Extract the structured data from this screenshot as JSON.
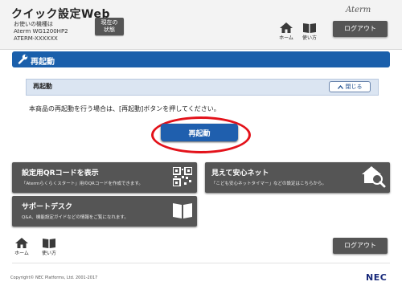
{
  "header": {
    "app_title": "クイック設定Web",
    "device_label": "お使いの機種は",
    "device_model": "Aterm WG1200HP2",
    "device_name": "ATERM-XXXXXX",
    "status_button_line1": "現在の",
    "status_button_line2": "状態",
    "brand": "Aterm",
    "home_label": "ホーム",
    "help_label": "使い方",
    "logout_label": "ログアウト"
  },
  "section": {
    "title": "再起動",
    "panel_title": "再起動",
    "close_label": "閉じる",
    "description": "本商品の再起動を行う場合は、[再起動]ボタンを押してください。",
    "restart_button": "再起動"
  },
  "tiles": [
    {
      "title": "設定用QRコードを表示",
      "subtitle": "「Atermらくらくスタート」用のQRコードを作成できます。",
      "icon": "qr-code-icon"
    },
    {
      "title": "見えて安心ネット",
      "subtitle": "「こども安心ネットタイマー」などの設定はこちらから。",
      "icon": "house-search-icon"
    },
    {
      "title": "サポートデスク",
      "subtitle": "Q&A、機能設定ガイドなどの情報をご覧になれます。",
      "icon": "book-icon"
    }
  ],
  "footer": {
    "home_label": "ホーム",
    "help_label": "使い方",
    "logout_label": "ログアウト",
    "copyright": "Copyright© NEC Platforms, Ltd. 2001-2017",
    "nec_logo": "NEC"
  },
  "colors": {
    "accent_blue": "#1a5fab",
    "panel_blue": "#dbe5f2",
    "tile_gray": "#555555",
    "highlight_red": "#e3121a"
  }
}
